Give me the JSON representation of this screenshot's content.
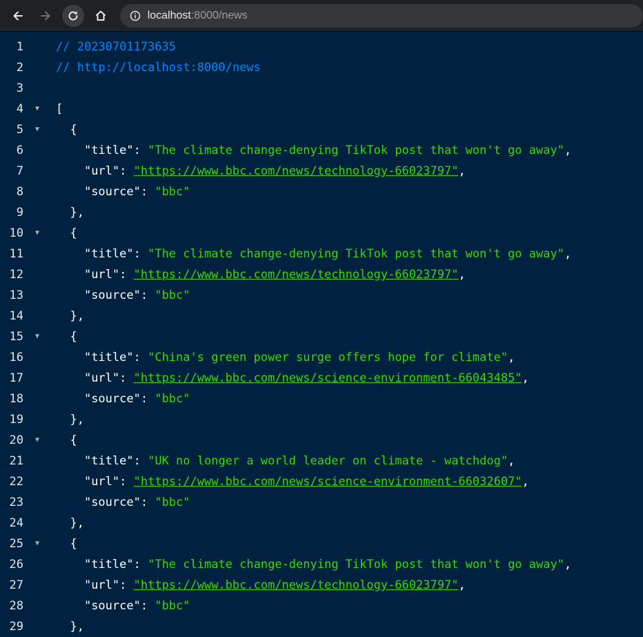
{
  "browser": {
    "host": "localhost",
    "path": ":8000/news"
  },
  "comments": [
    "// 20230701173635",
    "// http://localhost:8000/news"
  ],
  "labels": {
    "title": "\"title\"",
    "url": "\"url\"",
    "source": "\"source\""
  },
  "items": [
    {
      "title": "\"The climate change-denying TikTok post that won't go away\"",
      "url": "\"https://www.bbc.com/news/technology-66023797\"",
      "source": "\"bbc\""
    },
    {
      "title": "\"The climate change-denying TikTok post that won't go away\"",
      "url": "\"https://www.bbc.com/news/technology-66023797\"",
      "source": "\"bbc\""
    },
    {
      "title": "\"China's green power surge offers hope for climate\"",
      "url": "\"https://www.bbc.com/news/science-environment-66043485\"",
      "source": "\"bbc\""
    },
    {
      "title": "\"UK no longer a world leader on climate - watchdog\"",
      "url": "\"https://www.bbc.com/news/science-environment-66032607\"",
      "source": "\"bbc\""
    },
    {
      "title": "\"The climate change-denying TikTok post that won't go away\"",
      "url": "\"https://www.bbc.com/news/technology-66023797\"",
      "source": "\"bbc\""
    }
  ],
  "line_numbers": [
    "1",
    "2",
    "3",
    "4",
    "5",
    "6",
    "7",
    "8",
    "9",
    "10",
    "11",
    "12",
    "13",
    "14",
    "15",
    "16",
    "17",
    "18",
    "19",
    "20",
    "21",
    "22",
    "23",
    "24",
    "25",
    "26",
    "27",
    "28",
    "29"
  ]
}
